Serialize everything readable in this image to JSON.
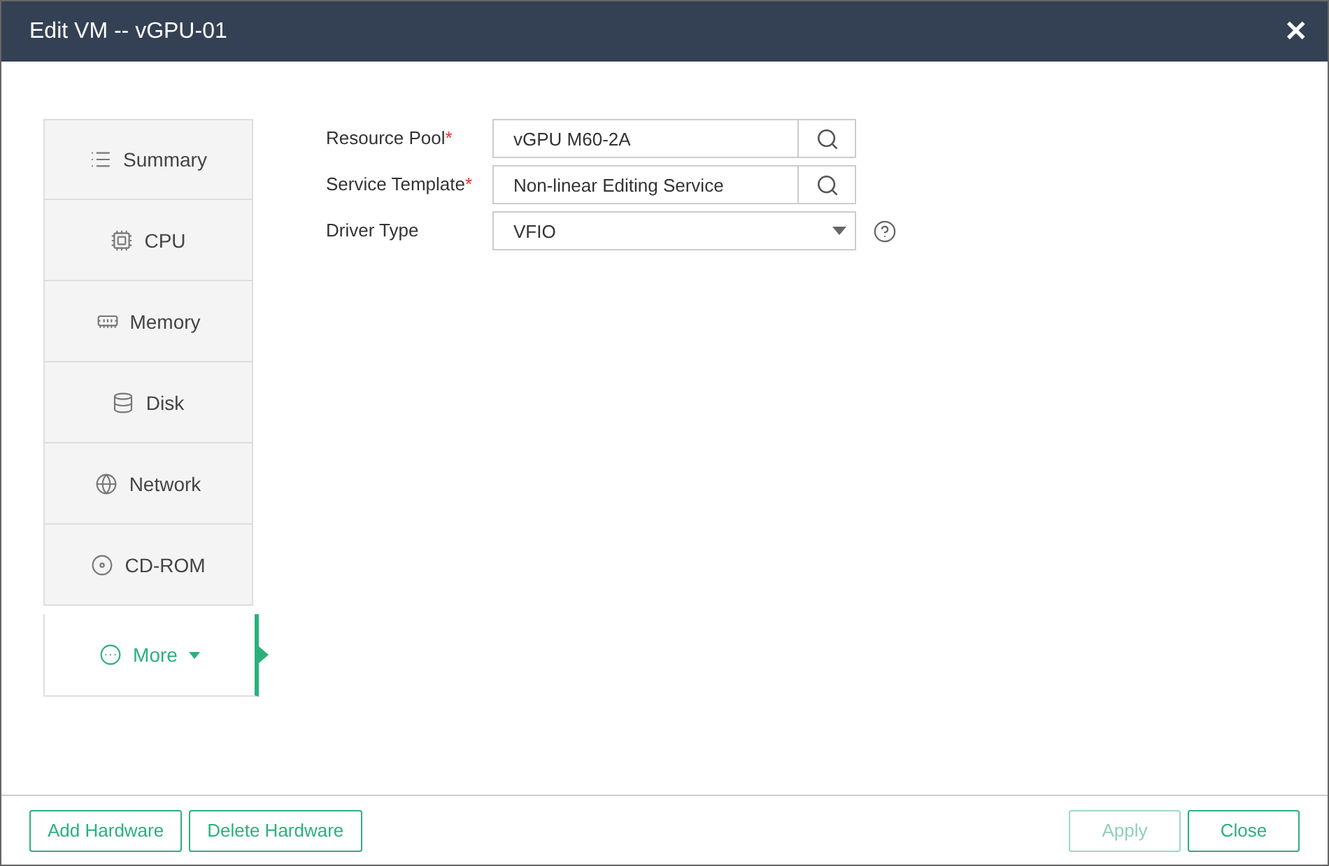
{
  "dialog": {
    "title": "Edit VM -- vGPU-01",
    "close": "✕"
  },
  "sidebar": {
    "items": [
      {
        "label": "Summary",
        "selected": false
      },
      {
        "label": "CPU",
        "selected": false
      },
      {
        "label": "Memory",
        "selected": false
      },
      {
        "label": "Disk",
        "selected": false
      },
      {
        "label": "Network",
        "selected": false
      },
      {
        "label": "CD-ROM",
        "selected": false
      },
      {
        "label": "More",
        "selected": true,
        "dropdown": true
      }
    ]
  },
  "form": {
    "fields": [
      {
        "kind": "search",
        "label": "Resource Pool",
        "required_mark": "*",
        "value": "vGPU M60-2A"
      },
      {
        "kind": "search",
        "label": "Service Template",
        "required_mark": "*",
        "value": "Non-linear Editing Service"
      },
      {
        "kind": "select",
        "label": "Driver Type",
        "value": "VFIO",
        "help": true
      }
    ]
  },
  "footer": {
    "left_buttons": [
      {
        "label": "Add Hardware",
        "disabled": false
      },
      {
        "label": "Delete Hardware",
        "disabled": false
      }
    ],
    "right_buttons": [
      {
        "label": "Apply",
        "disabled": true
      },
      {
        "label": "Close",
        "disabled": false
      }
    ]
  }
}
